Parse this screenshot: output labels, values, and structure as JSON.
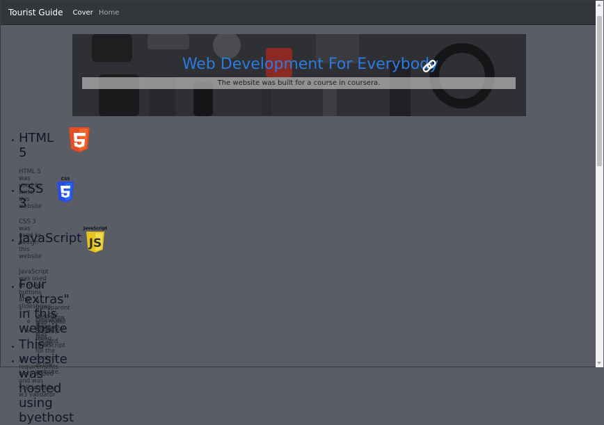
{
  "navbar": {
    "brand": "Tourist Guide",
    "links": [
      {
        "label": "Cover",
        "active": true
      },
      {
        "label": "Home",
        "active": false
      }
    ]
  },
  "banner": {
    "title": "Web Development For Everybody",
    "subtitle": "The website was built for a course in coursera."
  },
  "sections": [
    {
      "title": "HTML 5",
      "icon": "html5-icon",
      "desc": "HTML 5 was used to write this website"
    },
    {
      "title": "CSS 3",
      "icon": "css3-icon",
      "icon_label": "CSS",
      "desc": "CSS 3 was used to design this website"
    },
    {
      "title": "JavaScript",
      "icon": "javascript-icon",
      "icon_label": "JavaScript",
      "desc": "JavaScript was used to make buttons and slideshows"
    }
  ],
  "extras": {
    "title": "Four \"extras\" in this website",
    "items": [
      "A transparent nav-bar was made at the top",
      "A slideshow was created using JavaScript",
      "Dropdown nav-bar was created",
      "A card was made for the content in the website."
    ]
  },
  "hosting": {
    "title": "This website was hosted using byethost",
    "note": "All requirements were added and was validated by w3 validator"
  },
  "colors": {
    "page_bg": "#5a5d66",
    "navbar_bg": "#33363a",
    "banner_title": "#2b7be0",
    "html5": "#e44d26",
    "css3": "#264de4",
    "js": "#f0db4f"
  }
}
